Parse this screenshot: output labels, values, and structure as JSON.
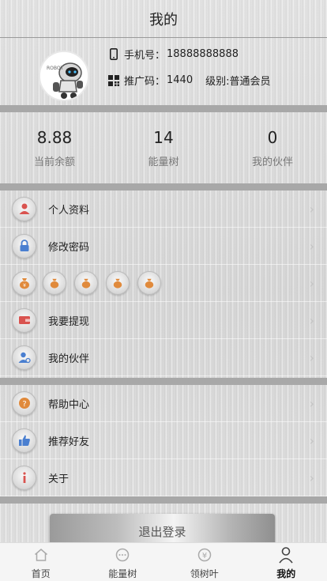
{
  "header": {
    "title": "我的"
  },
  "profile": {
    "phone_label": "手机号：",
    "phone": "18888888888",
    "promo_label": "推广码：",
    "promo_code": "1440",
    "level": "级别:普通会员"
  },
  "stats": [
    {
      "value": "8.88",
      "label": "当前余额"
    },
    {
      "value": "14",
      "label": "能量树"
    },
    {
      "value": "0",
      "label": "我的伙伴"
    }
  ],
  "menu1": [
    {
      "label": "个人资料",
      "icon": "user-icon"
    },
    {
      "label": "修改密码",
      "icon": "lock-icon"
    },
    {
      "label": "",
      "icon": "money-bag-icon"
    },
    {
      "label": "我要提现",
      "icon": "wallet-icon"
    },
    {
      "label": "我的伙伴",
      "icon": "partner-icon"
    }
  ],
  "menu2": [
    {
      "label": "帮助中心",
      "icon": "help-icon"
    },
    {
      "label": "推荐好友",
      "icon": "thumbs-up-icon"
    },
    {
      "label": "关于",
      "icon": "info-icon"
    }
  ],
  "logout": {
    "label": "退出登录"
  },
  "tabbar": [
    {
      "label": "首页",
      "icon": "home-icon",
      "active": false
    },
    {
      "label": "能量树",
      "icon": "chat-icon",
      "active": false
    },
    {
      "label": "领树叶",
      "icon": "yen-coin-icon",
      "active": false
    },
    {
      "label": "我的",
      "icon": "person-icon",
      "active": true
    }
  ],
  "colors": {
    "divider": "#a8a8a8",
    "tabbar_bg": "#f5f5f5",
    "icon_red": "#d9534f",
    "icon_blue": "#4a7fd0",
    "icon_orange": "#e08a3c"
  }
}
